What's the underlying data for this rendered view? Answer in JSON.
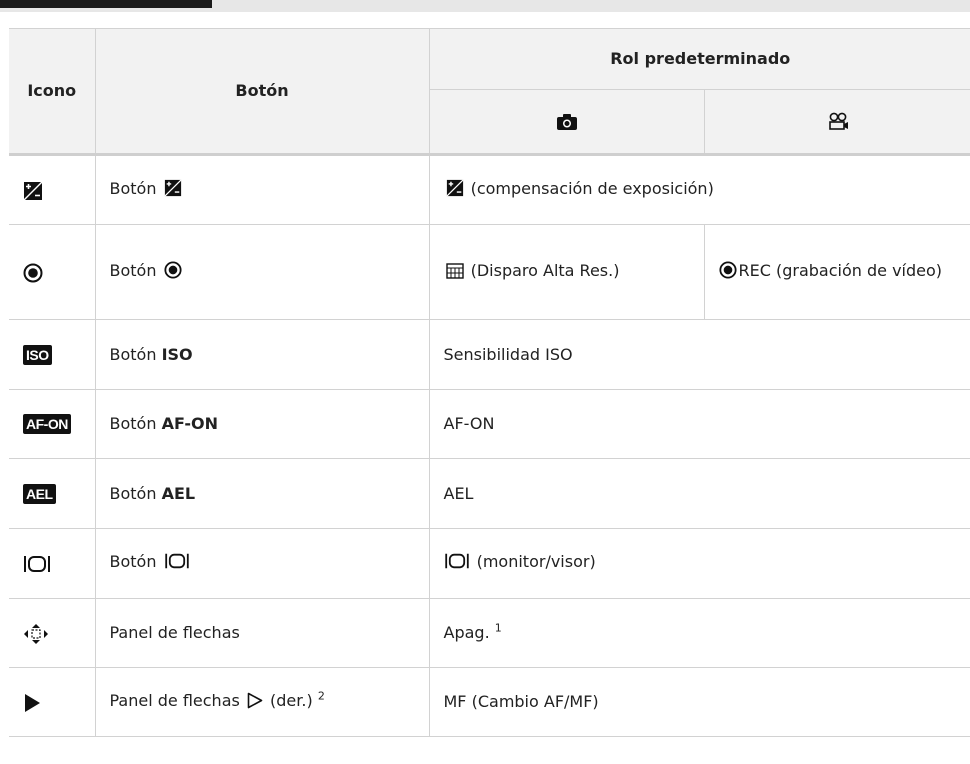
{
  "table": {
    "headers": {
      "icon": "Icono",
      "button": "Botón",
      "default_role": "Rol predeterminado"
    },
    "sub_header_icons": [
      "camera-icon",
      "movie-icon"
    ],
    "rows": [
      {
        "icon": "exposure-compensation-icon",
        "button_prefix": "Botón",
        "button_name": "",
        "role": "(compensación de exposición)"
      },
      {
        "icon": "record-icon",
        "button_prefix": "Botón",
        "button_name": "",
        "role_photo": "(Disparo Alta Res.)",
        "role_movie": "REC (grabación de vídeo)"
      },
      {
        "icon": "iso-icon",
        "icon_text": "ISO",
        "button_prefix": "Botón",
        "button_name": "ISO",
        "role": "Sensibilidad ISO"
      },
      {
        "icon": "af-on-icon",
        "icon_text": "AF-ON",
        "button_prefix": "Botón",
        "button_name": "AF-ON",
        "role": "AF-ON"
      },
      {
        "icon": "ael-icon",
        "icon_text": "AEL",
        "button_prefix": "Botón",
        "button_name": "AEL",
        "role": "AEL"
      },
      {
        "icon": "monitor-viewfinder-icon",
        "button_prefix": "Botón",
        "button_name": "",
        "role": "(monitor/visor)"
      },
      {
        "icon": "arrow-pad-icon",
        "button_prefix": "Panel de flechas",
        "button_name": "",
        "role": "Apag.",
        "role_footnote": "1"
      },
      {
        "icon": "play-icon",
        "button_prefix": "Panel de flechas",
        "button_suffix": "(der.)",
        "button_footnote": "2",
        "role": "MF (Cambio AF/MF)"
      }
    ]
  },
  "colors": {
    "header_background": "#f2f2f2",
    "border": "#d2d2d2",
    "text": "#222222",
    "top_band": "#e7e7e7"
  }
}
